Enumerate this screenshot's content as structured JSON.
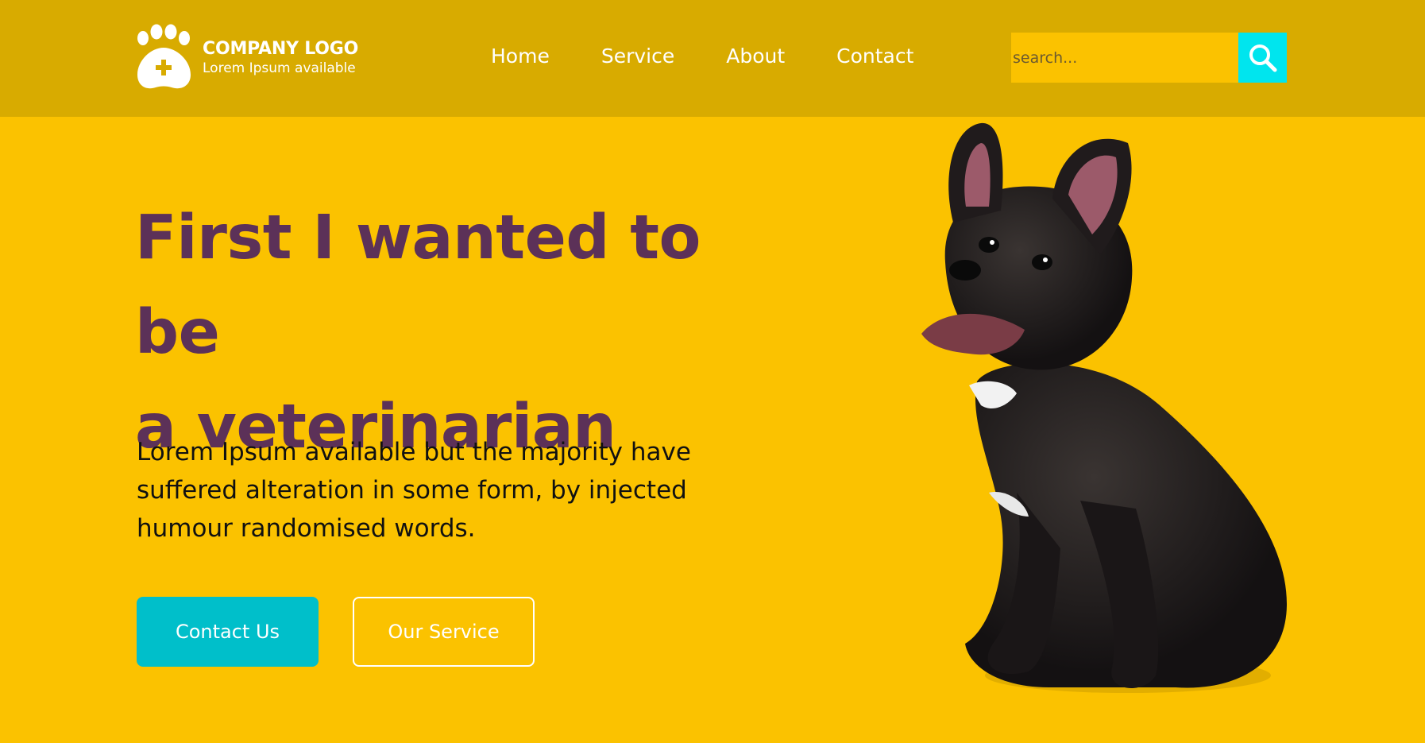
{
  "brand": {
    "title": "COMPANY LOGO",
    "subtitle": "Lorem Ipsum available",
    "icon": "paw-plus-icon"
  },
  "nav": {
    "items": [
      {
        "label": "Home"
      },
      {
        "label": "Service"
      },
      {
        "label": "About"
      },
      {
        "label": "Contact"
      }
    ]
  },
  "search": {
    "placeholder": "search...",
    "icon": "search-icon",
    "button_color": "#00e5ee"
  },
  "hero": {
    "title_line1": "First I wanted to be",
    "title_line2": "a veterinarian",
    "body": "Lorem Ipsum available but the majority have suffered alteration in some form, by injected humour randomised words.",
    "primary_button": "Contact Us",
    "secondary_button": "Our Service",
    "image": "french-bulldog-photo"
  },
  "colors": {
    "background": "#fbc200",
    "header": "#d8ab00",
    "title": "#5c3158",
    "accent": "#00bfca"
  }
}
